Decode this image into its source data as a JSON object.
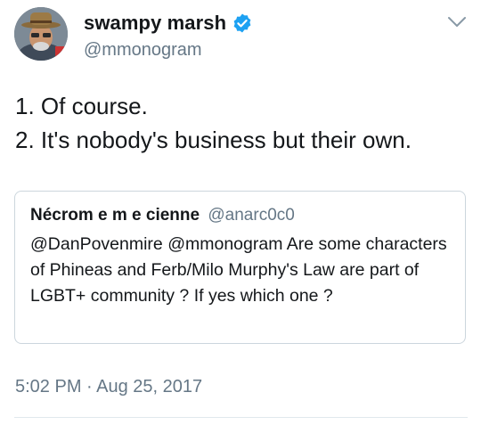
{
  "author": {
    "display_name": "swampy marsh",
    "handle": "@mmonogram",
    "verified": true,
    "avatar": "avatar-photo"
  },
  "tweet": {
    "lines": [
      "1. Of course.",
      "2. It's nobody's business but their own."
    ],
    "timestamp": "5:02 PM · Aug 25, 2017"
  },
  "quoted_tweet": {
    "display_name": "Nécrom e m e cienne",
    "handle": "@anarc0c0",
    "text": "@DanPovenmire @mmonogram Are some characters of Phineas and Ferb/Milo Murphy's Law are part of LGBT+ community ? If yes which one ?"
  },
  "icons": {
    "verified": "verified-badge-icon",
    "menu": "chevron-down-icon"
  },
  "colors": {
    "verified_blue": "#1da1f2",
    "secondary_text": "#657786",
    "border": "#ccd6dd"
  }
}
